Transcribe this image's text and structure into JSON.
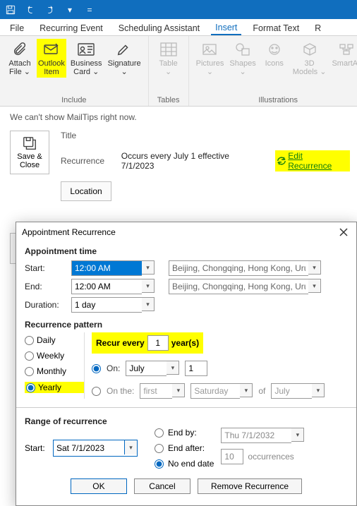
{
  "titlebar": {
    "dropdown_glyph": "▾"
  },
  "tabs": {
    "file": "File",
    "recurring": "Recurring Event",
    "sched": "Scheduling Assistant",
    "insert": "Insert",
    "format": "Format Text",
    "review_initial": "R"
  },
  "ribbon": {
    "include": {
      "title": "Include",
      "attach_file": "Attach\nFile ⌄",
      "outlook_item": "Outlook\nItem",
      "business_card": "Business\nCard ⌄",
      "signature": "Signature\n⌄"
    },
    "tables": {
      "title": "Tables",
      "table": "Table\n⌄"
    },
    "illustrations": {
      "title": "Illustrations",
      "pictures": "Pictures\n⌄",
      "shapes": "Shapes\n⌄",
      "icons": "Icons",
      "models": "3D\nModels ⌄",
      "smartart": "SmartAr"
    }
  },
  "mailtips": "We can't show MailTips right now.",
  "form": {
    "save_close": "Save &\nClose",
    "title_label": "Title",
    "recurrence_label": "Recurrence",
    "recurrence_text": "Occurs every July 1 effective 7/1/2023",
    "edit_recurrence": "Edit Recurrence",
    "location_btn": "Location"
  },
  "dialog": {
    "title": "Appointment Recurrence",
    "sections": {
      "time": "Appointment time",
      "pattern": "Recurrence pattern",
      "range": "Range of recurrence"
    },
    "labels": {
      "start": "Start:",
      "end": "End:",
      "duration": "Duration:"
    },
    "time": {
      "start_value": "12:00 AM",
      "end_value": "12:00 AM",
      "duration_value": "1 day",
      "tz": "Beijing, Chongqing, Hong Kong, Urumc"
    },
    "pattern": {
      "options": {
        "daily": "Daily",
        "weekly": "Weekly",
        "monthly": "Monthly",
        "yearly": "Yearly"
      },
      "recur_every_prefix": "Recur every",
      "recur_every_years_value": "1",
      "recur_every_suffix": "year(s)",
      "on_label": "On:",
      "on_month": "July",
      "on_day": "1",
      "onthe_label": "On the:",
      "onthe_ord": "first",
      "onthe_dow": "Saturday",
      "of_label": "of",
      "onthe_month": "July"
    },
    "range": {
      "start_label": "Start:",
      "start_value": "Sat 7/1/2023",
      "endby_label": "End by:",
      "endby_value": "Thu 7/1/2032",
      "endafter_label": "End after:",
      "endafter_value": "10",
      "endafter_suffix": "occurrences",
      "noend_label": "No end date"
    },
    "buttons": {
      "ok": "OK",
      "cancel": "Cancel",
      "remove": "Remove Recurrence"
    }
  }
}
